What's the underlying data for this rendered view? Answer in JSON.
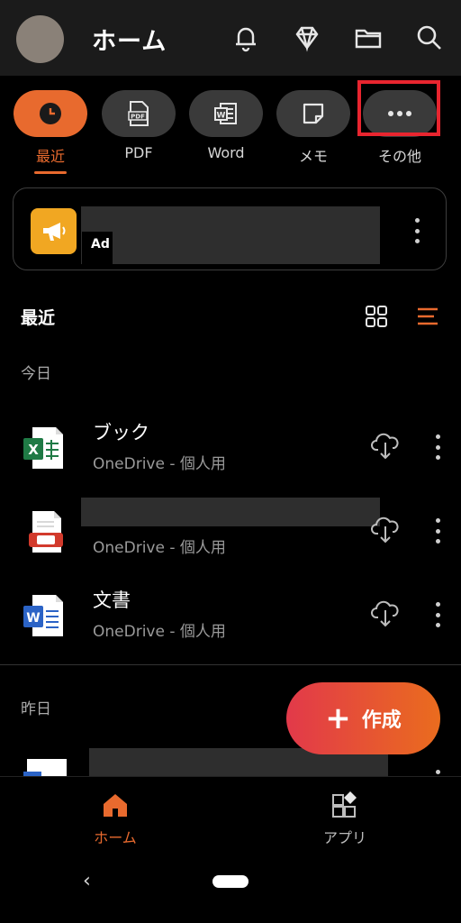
{
  "header": {
    "title": "ホーム",
    "icons": [
      "bell-icon",
      "diamond-icon",
      "folder-icon",
      "search-icon"
    ]
  },
  "filters": [
    {
      "label": "最近",
      "icon": "clock-icon",
      "active": true
    },
    {
      "label": "PDF",
      "icon": "pdf-icon",
      "active": false
    },
    {
      "label": "Word",
      "icon": "word-icon",
      "active": false
    },
    {
      "label": "メモ",
      "icon": "note-icon",
      "active": false
    },
    {
      "label": "その他",
      "icon": "more-icon",
      "active": false
    }
  ],
  "ad": {
    "label": "Ad",
    "icon": "megaphone-icon"
  },
  "recent": {
    "title": "最近",
    "today_label": "今日",
    "yesterday_label": "昨日",
    "files": [
      {
        "name": "ブック",
        "location": "OneDrive - 個人用",
        "type": "excel"
      },
      {
        "name": "",
        "location": "OneDrive - 個人用",
        "type": "pdf"
      },
      {
        "name": "文書",
        "location": "OneDrive - 個人用",
        "type": "word"
      }
    ]
  },
  "fab": {
    "label": "作成",
    "icon": "plus-icon"
  },
  "bottom_nav": [
    {
      "label": "ホーム",
      "icon": "home-icon",
      "active": true
    },
    {
      "label": "アプリ",
      "icon": "apps-icon",
      "active": false
    }
  ],
  "colors": {
    "accent": "#e86a2e",
    "highlight": "#e8252f",
    "excel": "#1f7a45",
    "word": "#2b63c6",
    "pdf": "#d23a2c"
  }
}
